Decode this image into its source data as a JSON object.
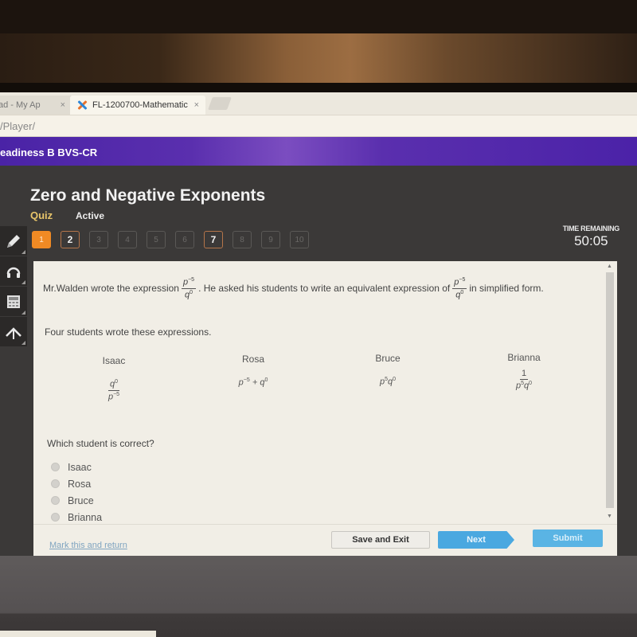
{
  "browser": {
    "tabs": [
      {
        "label": "ad - My Ap",
        "active": false,
        "close": "×"
      },
      {
        "label": "FL-1200700-Mathematic",
        "active": true,
        "close": "×",
        "icon": "edgenuity-x-icon"
      }
    ],
    "address": "/Player/"
  },
  "course": {
    "title": "eadiness B BVS-CR",
    "bar_color": "#4a23a6"
  },
  "header": {
    "title": "Zero and Negative Exponents",
    "type": "Quiz",
    "status": "Active"
  },
  "question_nav": {
    "items": [
      {
        "label": "1",
        "state": "current"
      },
      {
        "label": "2",
        "state": "answered"
      },
      {
        "label": "3",
        "state": "unanswered"
      },
      {
        "label": "4",
        "state": "unanswered"
      },
      {
        "label": "5",
        "state": "unanswered"
      },
      {
        "label": "6",
        "state": "unanswered"
      },
      {
        "label": "7",
        "state": "answered"
      },
      {
        "label": "8",
        "state": "unanswered"
      },
      {
        "label": "9",
        "state": "unanswered"
      },
      {
        "label": "10",
        "state": "unanswered"
      }
    ],
    "accent": "#f08a24"
  },
  "timer": {
    "label": "TIME REMAINING",
    "value": "50:05"
  },
  "tools": [
    {
      "name": "pencil-icon"
    },
    {
      "name": "headphones-icon"
    },
    {
      "name": "calculator-icon"
    },
    {
      "name": "reference-icon"
    }
  ],
  "question": {
    "part1": "Mr.Walden wrote the expression",
    "part2": ". He asked his students to write an equivalent expression of",
    "part3": "in simplified form.",
    "expr": {
      "num_base": "p",
      "num_exp": "−5",
      "den_base": "q",
      "den_exp": "0"
    },
    "intro": "Four students wrote these expressions.",
    "students": [
      {
        "name": "Isaac",
        "expr": "q^0 / p^-5"
      },
      {
        "name": "Rosa",
        "expr": "p^-5 + q^0"
      },
      {
        "name": "Bruce",
        "expr": "p^5 q^0"
      },
      {
        "name": "Brianna",
        "expr": "1 / p^5 q^0"
      }
    ],
    "prompt": "Which student is correct?",
    "options": [
      "Isaac",
      "Rosa",
      "Bruce",
      "Brianna"
    ]
  },
  "footer": {
    "mark_link": "Mark this and return",
    "save": "Save and Exit",
    "next": "Next",
    "submit": "Submit"
  },
  "math": {
    "p": "p",
    "q": "q",
    "one": "1",
    "neg5": "−5",
    "pos5": "5",
    "zero": "0",
    "plus": "+"
  }
}
